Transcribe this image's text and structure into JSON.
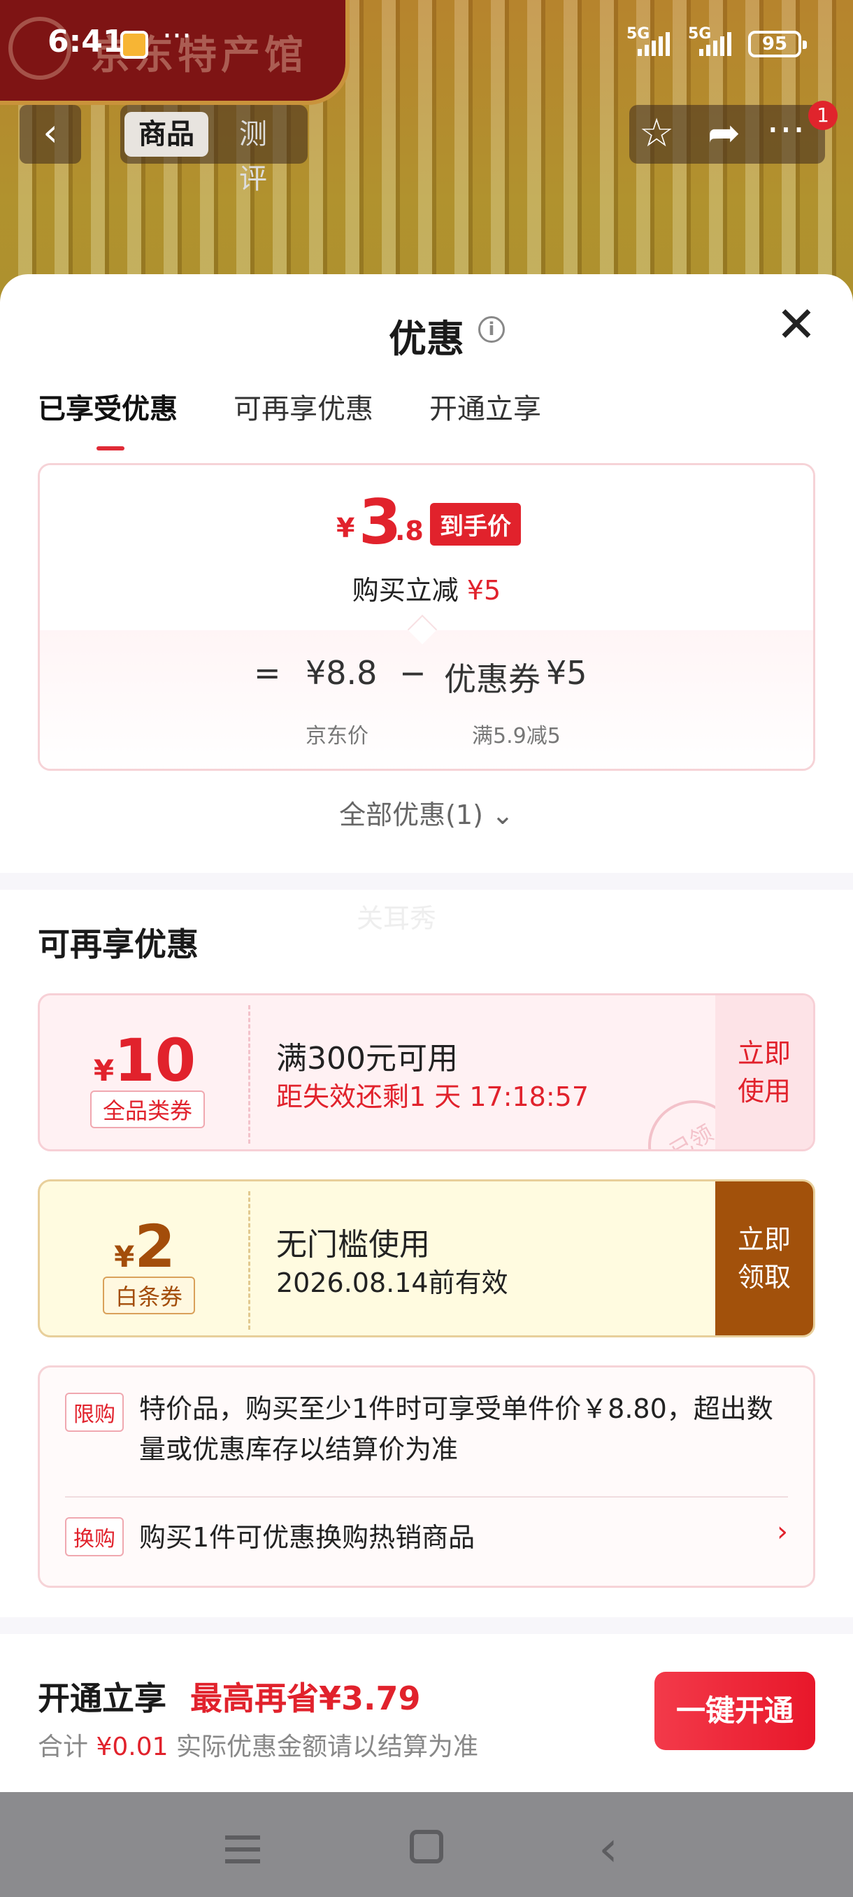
{
  "status_bar": {
    "time": "6:41",
    "more": "···",
    "net1": "5G",
    "net2": "5G",
    "battery": "95"
  },
  "background": {
    "banner_text": "京东特产馆",
    "tabs": [
      "商品",
      "测评"
    ],
    "notification_count": "1"
  },
  "sheet": {
    "title": "优惠",
    "tabs": [
      "已享受优惠",
      "可再享优惠",
      "开通立享"
    ],
    "price": {
      "yen": "¥",
      "integer": "3",
      "decimal": ".8",
      "tag": "到手价",
      "reduce_label": "购买立减",
      "reduce_value": "¥5"
    },
    "formula": {
      "eq": "=",
      "jd_price": "¥8.8",
      "minus": "−",
      "coupon_label": "优惠券",
      "coupon_value": "¥5",
      "jd_price_label": "京东价",
      "coupon_rule": "满5.9减5"
    },
    "all_discounts": "全部优惠(1)",
    "faded_text": "关耳秀",
    "section_title": "可再享优惠",
    "coupons": [
      {
        "yen": "¥",
        "amount": "10",
        "kind": "全品类券",
        "title": "满300元可用",
        "subtitle": "距失效还剩1 天 17:18:57",
        "cta": "立即使用",
        "stamp": "已领"
      },
      {
        "yen": "¥",
        "amount": "2",
        "kind": "白条券",
        "title": "无门槛使用",
        "subtitle": "2026.08.14前有效",
        "cta": "立即领取"
      }
    ],
    "notes": [
      {
        "tag": "限购",
        "text": "特价品，购买至少1件时可享受单件价￥8.80，超出数量或优惠库存以结算价为准"
      },
      {
        "tag": "换购",
        "text": "购买1件可优惠换购热销商品"
      }
    ],
    "footer": {
      "title": "开通立享",
      "save": "最高再省¥3.79",
      "total_label": "合计",
      "total_value": "¥0.01",
      "total_note": "实际优惠金额请以结算为准",
      "button": "一键开通"
    }
  }
}
